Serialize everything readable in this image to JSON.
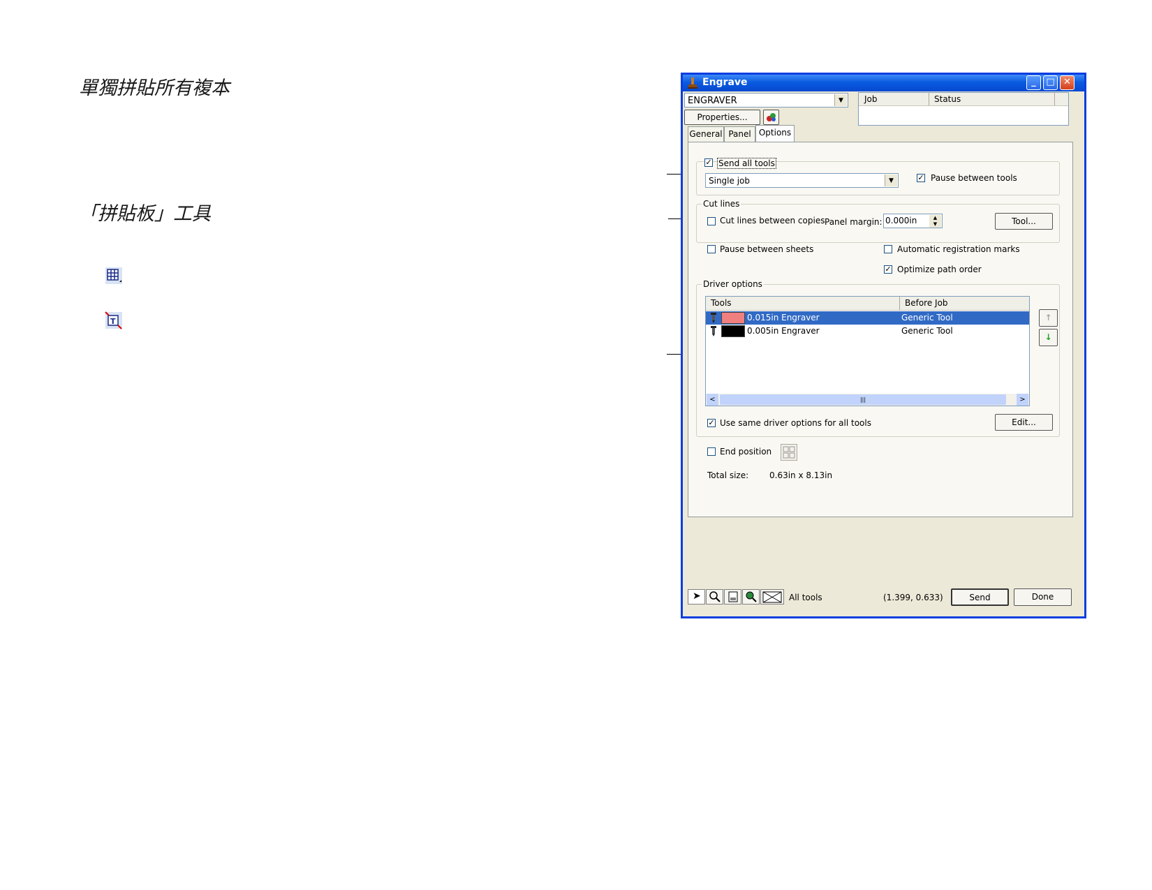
{
  "doc": {
    "heading1": "單獨拼貼所有複本",
    "heading2": "「拼貼板」工具"
  },
  "icons": {
    "tile_tool": "grid-table-icon",
    "tile_text_tool": "text-frame-icon",
    "app": "engrave-stamp-icon"
  },
  "window": {
    "title": "Engrave",
    "minimize": "_",
    "maximize": "□",
    "close": "✕"
  },
  "device": {
    "selected": "ENGRAVER",
    "properties_label": "Properties..."
  },
  "job_table": {
    "col_job": "Job",
    "col_status": "Status"
  },
  "tabs": [
    "General",
    "Panel",
    "Options"
  ],
  "send_all_tools": {
    "label": "Send all tools",
    "checked": true
  },
  "job_mode": {
    "selected": "Single job"
  },
  "pause_between_tools": {
    "label": "Pause between tools",
    "checked": true
  },
  "cut_lines": {
    "legend": "Cut lines",
    "between_copies_label": "Cut lines between copies",
    "between_copies_checked": false,
    "panel_margin_label": "Panel margin:",
    "panel_margin_value": "0.000in",
    "tool_button": "Tool..."
  },
  "pause_between_sheets": {
    "label": "Pause between sheets",
    "checked": false
  },
  "auto_registration": {
    "label": "Automatic registration marks",
    "checked": false
  },
  "optimize_path": {
    "label": "Optimize path order",
    "checked": true
  },
  "driver_options": {
    "legend": "Driver options",
    "col_tools": "Tools",
    "col_before_job": "Before Job",
    "rows": [
      {
        "tool": "0.015in Engraver",
        "before_job": "Generic Tool",
        "swatch": "#f08080",
        "selected": true
      },
      {
        "tool": "0.005in Engraver",
        "before_job": "Generic Tool",
        "swatch": "#000000",
        "selected": false
      }
    ],
    "same_options_label": "Use same driver options for all tools",
    "same_options_checked": true,
    "edit_button": "Edit..."
  },
  "end_position": {
    "label": "End position",
    "checked": false
  },
  "total_size": {
    "label": "Total size:",
    "value": "0.63in x  8.13in"
  },
  "status_bar": {
    "tools_label": "All tools",
    "coords": "(1.399, 0.633)",
    "send_button": "Send",
    "done_button": "Done"
  },
  "colors": {
    "title_bar": "#0a5be0",
    "window_bg": "#ece9d8",
    "selection": "#316ac5"
  }
}
